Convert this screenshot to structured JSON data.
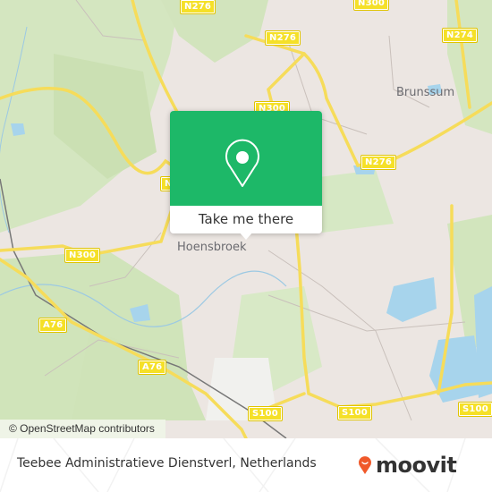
{
  "map": {
    "places": [
      {
        "name": "Hoensbroek"
      },
      {
        "name": "Brunssum"
      }
    ],
    "road_shields": [
      "N276",
      "N300",
      "N276",
      "N274",
      "N300",
      "N276",
      "N",
      "N300",
      "A76",
      "A76",
      "S100",
      "S100",
      "S100"
    ],
    "attribution": "© OpenStreetMap contributors"
  },
  "popup": {
    "icon": "map-pin-icon",
    "action_label": "Take me there",
    "color": "#1db868"
  },
  "footer": {
    "location_title": "Teebee Administratieve Dienstverl, Netherlands",
    "brand": "moovit",
    "brand_color": "#f0592a"
  }
}
